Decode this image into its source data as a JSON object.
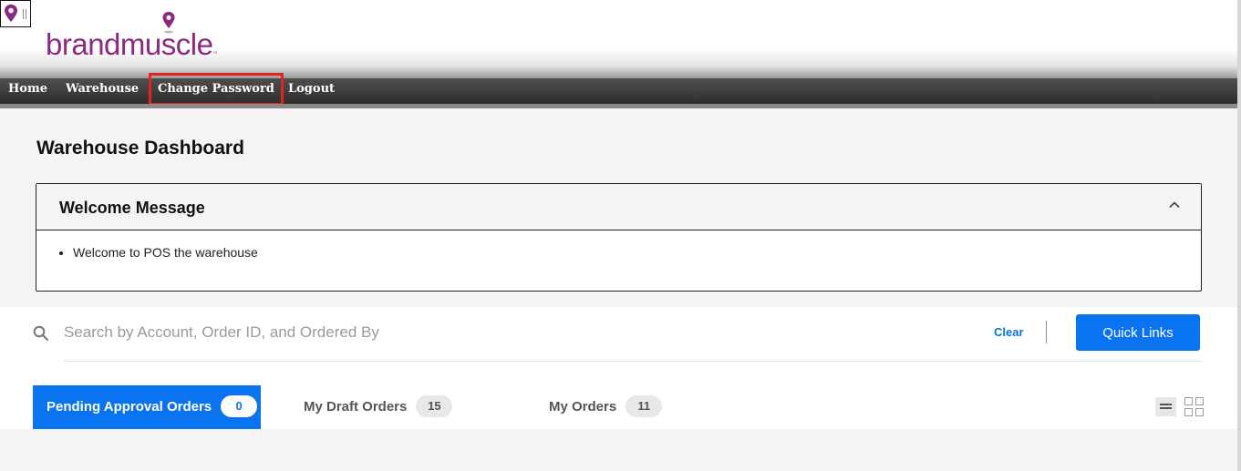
{
  "brand": {
    "name": "brandmuscle",
    "tm": "™",
    "color": "#8c2880"
  },
  "nav": {
    "items": [
      {
        "label": "Home"
      },
      {
        "label": "Warehouse"
      },
      {
        "label": "Change Password",
        "highlighted": true
      },
      {
        "label": "Logout"
      }
    ]
  },
  "page": {
    "title": "Warehouse Dashboard"
  },
  "welcome": {
    "title": "Welcome Message",
    "messages": [
      "Welcome to POS the warehouse"
    ]
  },
  "search": {
    "placeholder": "Search by Account, Order ID, and Ordered By",
    "value": "",
    "clear_label": "Clear",
    "quick_links_label": "Quick Links"
  },
  "tabs": [
    {
      "label": "Pending Approval Orders",
      "count": "0",
      "active": true
    },
    {
      "label": "My Draft Orders",
      "count": "15",
      "active": false
    },
    {
      "label": "My Orders",
      "count": "11",
      "active": false
    }
  ],
  "view_toggle": {
    "selected": "list"
  },
  "colors": {
    "accent": "#0a73f0",
    "highlight_border": "#e32222",
    "nav_bg": "#3a3a3a"
  },
  "icons": [
    "map-pin-icon",
    "search-icon",
    "chevron-up-icon",
    "list-view-icon",
    "grid-view-icon"
  ]
}
